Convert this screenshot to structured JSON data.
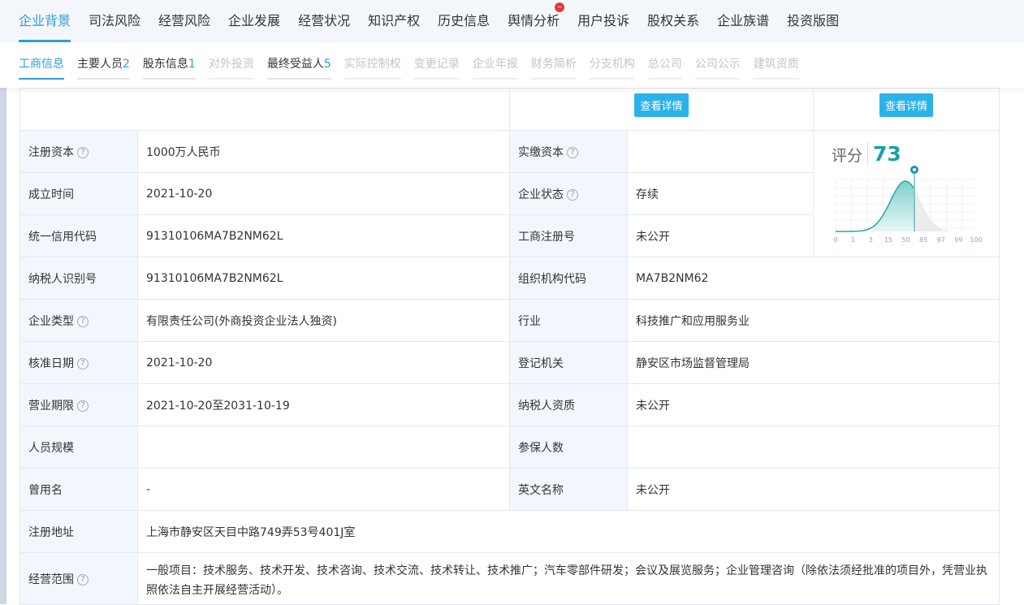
{
  "top_tabs": [
    "企业背景",
    "司法风险",
    "经营风险",
    "企业发展",
    "经营状况",
    "知识产权",
    "历史信息",
    "舆情分析",
    "用户投诉",
    "股权关系",
    "企业族谱",
    "投资版图"
  ],
  "sub_tabs": [
    {
      "label": "工商信息",
      "count": ""
    },
    {
      "label": "主要人员",
      "count": "2"
    },
    {
      "label": "股东信息",
      "count": "1"
    },
    {
      "label": "对外投资",
      "count": ""
    },
    {
      "label": "最终受益人",
      "count": "5"
    },
    {
      "label": "实际控制权",
      "count": ""
    },
    {
      "label": "变更记录",
      "count": ""
    },
    {
      "label": "企业年报",
      "count": ""
    },
    {
      "label": "财务简析",
      "count": ""
    },
    {
      "label": "分支机构",
      "count": ""
    },
    {
      "label": "总公司",
      "count": ""
    },
    {
      "label": "公司公示",
      "count": ""
    },
    {
      "label": "建筑资质",
      "count": ""
    }
  ],
  "detail_button": "查看详情",
  "rows": [
    {
      "l1": "注册资本",
      "v1": "1000万人民币",
      "l2": "实缴资本",
      "v2": ""
    },
    {
      "l1": "成立时间",
      "v1": "2021-10-20",
      "l2": "企业状态",
      "v2": "存续"
    },
    {
      "l1": "统一信用代码",
      "v1": "91310106MA7B2NM62L",
      "l2": "工商注册号",
      "v2": "未公开"
    },
    {
      "l1": "纳税人识别号",
      "v1": "91310106MA7B2NM62L",
      "l2": "组织机构代码",
      "v2": "MA7B2NM62"
    },
    {
      "l1": "企业类型",
      "v1": "有限责任公司(外商投资企业法人独资)",
      "l2": "行业",
      "v2": "科技推广和应用服务业"
    },
    {
      "l1": "核准日期",
      "v1": "2021-10-20",
      "l2": "登记机关",
      "v2": "静安区市场监督管理局"
    },
    {
      "l1": "营业期限",
      "v1": "2021-10-20至2031-10-19",
      "l2": "纳税人资质",
      "v2": "未公开"
    },
    {
      "l1": "人员规模",
      "v1": "",
      "l2": "参保人数",
      "v2": ""
    },
    {
      "l1": "曾用名",
      "v1": "-",
      "l2": "英文名称",
      "v2": "未公开"
    }
  ],
  "address": {
    "label": "注册地址",
    "value": "上海市静安区天目中路749弄53号401J室"
  },
  "scope": {
    "label": "经营范围",
    "value": "一般项目：技术服务、技术开发、技术咨询、技术交流、技术转让、技术推广；汽车零部件研发；会议及展览服务；企业管理咨询（除依法须经批准的项目外，凭营业执照依法自主开展经营活动）。"
  },
  "score": {
    "label": "评分",
    "value": "73",
    "ticks": [
      "0",
      "1",
      "3",
      "15",
      "50",
      "85",
      "97",
      "99",
      "100"
    ]
  },
  "help_mark": "?"
}
